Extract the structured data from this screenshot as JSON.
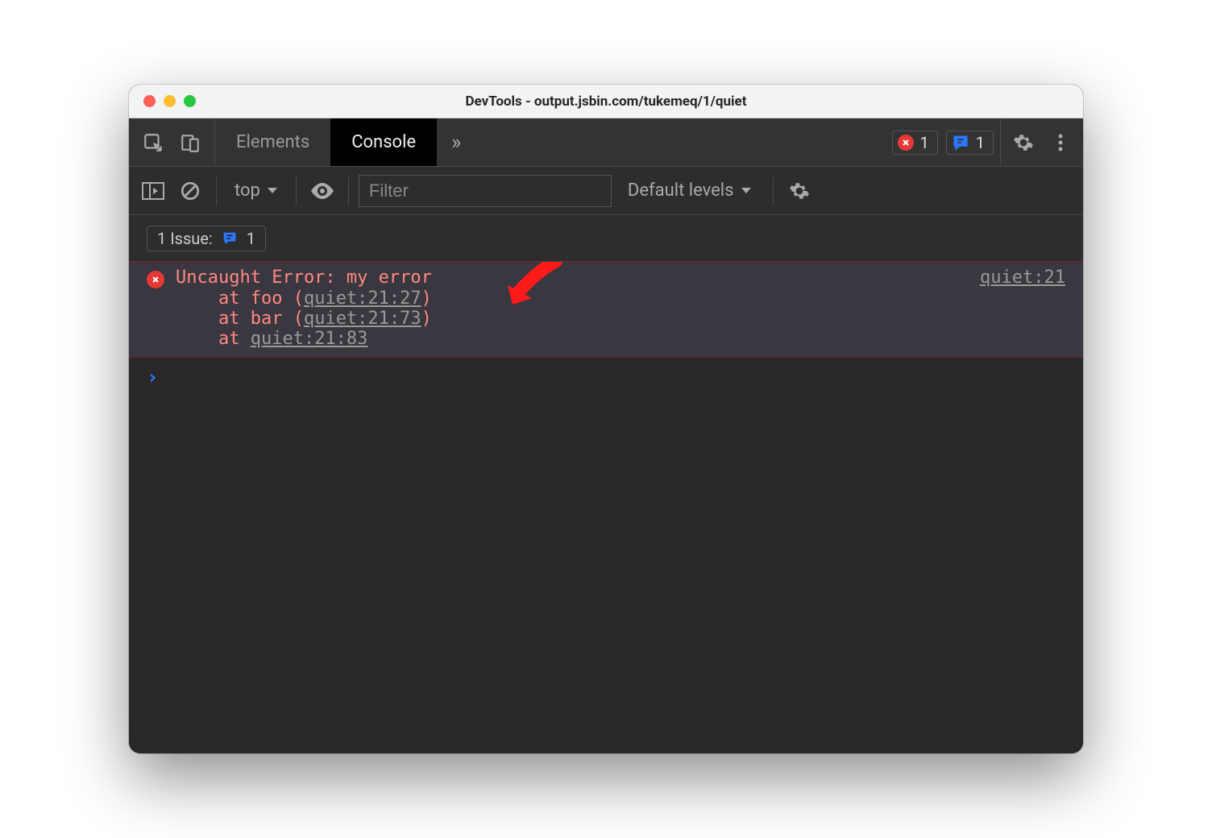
{
  "window": {
    "title": "DevTools - output.jsbin.com/tukemeq/1/quiet"
  },
  "tabs": {
    "elements": "Elements",
    "console": "Console",
    "overflow_glyph": "»"
  },
  "badges": {
    "error_count": "1",
    "issue_count": "1"
  },
  "filterbar": {
    "context_label": "top",
    "filter_placeholder": "Filter",
    "levels_label": "Default levels"
  },
  "issuesbar": {
    "label_prefix": "1 Issue:",
    "count": "1"
  },
  "error": {
    "message": "Uncaught Error: my error",
    "source_link": "quiet:21",
    "stack": [
      {
        "prefix": "    at foo (",
        "link": "quiet:21:27",
        "suffix": ")"
      },
      {
        "prefix": "    at bar (",
        "link": "quiet:21:73",
        "suffix": ")"
      },
      {
        "prefix": "    at ",
        "link": "quiet:21:83",
        "suffix": ""
      }
    ]
  },
  "prompt": {
    "glyph": "›"
  }
}
